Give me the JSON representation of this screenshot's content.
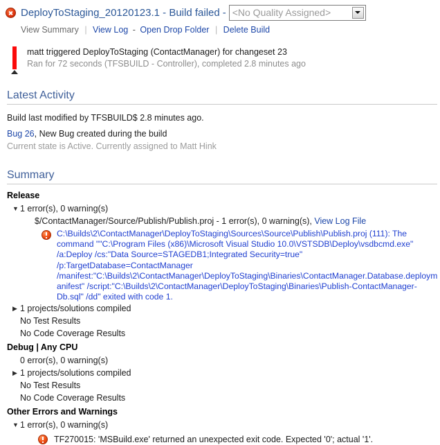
{
  "header": {
    "status_icon": "error-x-circle-icon",
    "build_name": "DeployToStaging_20120123.1 - Build failed",
    "separator_dash": "-",
    "quality_value": "<No Quality Assigned>",
    "quality_caret_icon": "chevron-down-icon"
  },
  "nav": {
    "view_summary": "View Summary",
    "view_log": "View Log",
    "dash": "-",
    "open_drop_folder": "Open Drop Folder",
    "delete_build": "Delete Build"
  },
  "trigger": {
    "main": "matt triggered DeployToStaging (ContactManager) for changeset 23",
    "sub": "Ran for 72 seconds (TFSBUILD - Controller), completed 2.8 minutes ago",
    "bar_color": "#fb0a0a"
  },
  "latest_activity": {
    "heading": "Latest Activity",
    "modified": "Build last modified by TFSBUILD$ 2.8 minutes ago.",
    "bug_link": "Bug 26",
    "bug_rest": ", New Bug created during the build",
    "bug_state": "Current state is Active. Currently assigned to Matt Hink"
  },
  "summary": {
    "heading": "Summary",
    "configurations": [
      {
        "name": "Release",
        "counts": "1 error(s), 0 warning(s)",
        "counts_triangle": "▼",
        "project_line": "$/ContactManager/Source/Publish/Publish.proj - 1 error(s), 0 warning(s), ",
        "project_log_link": "View Log File",
        "error_text": "C:\\Builds\\2\\ContactManager\\DeployToStaging\\Sources\\Source\\Publish\\Publish.proj (111): The command \"\"C:\\Program Files (x86)\\Microsoft Visual Studio 10.0\\VSTSDB\\Deploy\\vsdbcmd.exe\" /a:Deploy /cs:\"Data Source=STAGEDB1;Integrated Security=true\" /p:TargetDatabase=ContactManager /manifest:\"C:\\Builds\\2\\ContactManager\\DeployToStaging\\Binaries\\ContactManager.Database.deploymanifest\" /script:\"C:\\Builds\\2\\ContactManager\\DeployToStaging\\Binaries\\Publish-ContactManager-Db.sql\" /dd\" exited with code 1.",
        "compiled": "1 projects/solutions compiled",
        "compiled_triangle": "▶",
        "no_tests": "No Test Results",
        "no_coverage": "No Code Coverage Results"
      },
      {
        "name": "Debug | Any CPU",
        "counts": "0 error(s), 0 warning(s)",
        "counts_triangle": "",
        "compiled": "1 projects/solutions compiled",
        "compiled_triangle": "▶",
        "no_tests": "No Test Results",
        "no_coverage": "No Code Coverage Results"
      }
    ],
    "other_errors": {
      "name": "Other Errors and Warnings",
      "counts": "1 error(s), 0 warning(s)",
      "counts_triangle": "▼",
      "error_text": "TF270015: 'MSBuild.exe' returned an unexpected exit code. Expected '0'; actual '1'."
    }
  },
  "colors": {
    "heading_blue": "#40609a",
    "link_blue": "#1d47a8",
    "error_blue": "#1f3fd0",
    "error_red": "#f4561a",
    "muted_gray": "#9a9a9a"
  }
}
